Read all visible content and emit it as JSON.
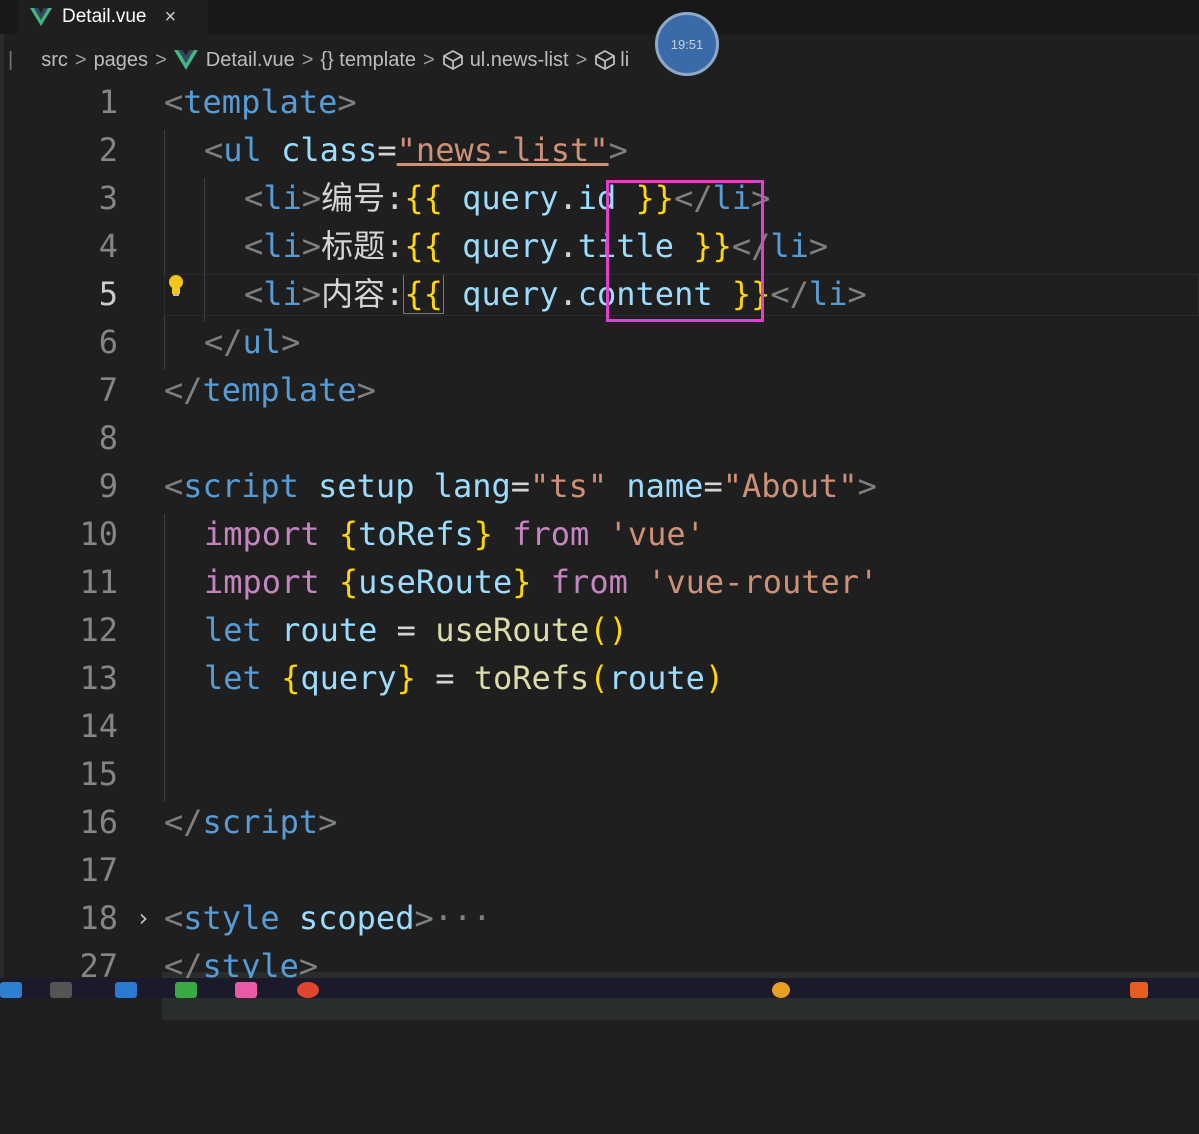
{
  "tab": {
    "filename": "Detail.vue",
    "close_glyph": "×"
  },
  "breadcrumb": {
    "items": [
      "src",
      "pages",
      "Detail.vue",
      "{} template",
      "ul.news-list",
      "li"
    ],
    "separator": ">"
  },
  "clock": {
    "time": "19:51"
  },
  "line_numbers": [
    "1",
    "2",
    "3",
    "4",
    "5",
    "6",
    "7",
    "8",
    "9",
    "10",
    "11",
    "12",
    "13",
    "14",
    "15",
    "16",
    "17",
    "18",
    "27"
  ],
  "code": {
    "l1": {
      "open": "<",
      "tag": "template",
      "close": ">"
    },
    "l2": {
      "open": "<",
      "tag": "ul",
      "attr": " class",
      "eq": "=",
      "val": "\"news-list\"",
      "close": ">"
    },
    "l3": {
      "open": "<",
      "tag": "li",
      "close": ">",
      "label": "编号:",
      "lb": "{{",
      "obj": " query",
      "dot": ".",
      "prop": "id",
      "rb": " }}",
      "end_open": "</",
      "end_tag": "li",
      "end_close": ">"
    },
    "l4": {
      "open": "<",
      "tag": "li",
      "close": ">",
      "label": "标题:",
      "lb": "{{",
      "obj": " query",
      "dot": ".",
      "prop": "title",
      "rb": " }}",
      "end_open": "</",
      "end_tag": "li",
      "end_close": ">"
    },
    "l5": {
      "open": "<",
      "tag": "li",
      "close": ">",
      "label": "内容:",
      "lb": "{{",
      "obj": " query",
      "dot": ".",
      "prop": "content",
      "rb": " }}",
      "end_open": "</",
      "end_tag": "li",
      "end_close": ">"
    },
    "l6": {
      "open": "</",
      "tag": "ul",
      "close": ">"
    },
    "l7": {
      "open": "</",
      "tag": "template",
      "close": ">"
    },
    "l9": {
      "open": "<",
      "tag": "script",
      "a1": " setup",
      "a2": " lang",
      "eq": "=",
      "v1": "\"ts\"",
      "a3": " name",
      "v2": "\"About\"",
      "close": ">"
    },
    "l10": {
      "kw": "import",
      "lb": " {",
      "id": "toRefs",
      "rb": "}",
      "from": " from",
      "str": " 'vue'"
    },
    "l11": {
      "kw": "import",
      "lb": " {",
      "id": "useRoute",
      "rb": "}",
      "from": " from",
      "str": " 'vue-router'"
    },
    "l12": {
      "kw": "let",
      "id": " route",
      "op": " = ",
      "fn": "useRoute",
      "paren": "()"
    },
    "l13": {
      "kw": "let",
      "lb": " {",
      "id": "query",
      "rb": "}",
      "op": " = ",
      "fn": "toRefs",
      "po": "(",
      "arg": "route",
      "pc": ")"
    },
    "l16": {
      "open": "</",
      "tag": "script",
      "close": ">"
    },
    "l18": {
      "open": "<",
      "tag": "style",
      "attr": " scoped",
      "close": ">",
      "ellipsis": "···"
    },
    "l27": {
      "open": "</",
      "tag": "style",
      "close": ">"
    }
  },
  "colors": {
    "highlight_box": "#e040d0",
    "editor_bg": "#1f1f1f"
  }
}
